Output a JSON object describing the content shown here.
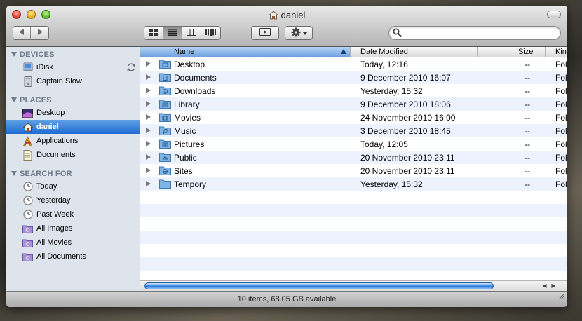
{
  "window": {
    "title": "daniel",
    "title_icon": "home-icon"
  },
  "toolbar": {
    "back_icon": "back-arrow-icon",
    "forward_icon": "forward-arrow-icon",
    "view_modes": [
      "icon-view-icon",
      "list-view-icon",
      "column-view-icon",
      "coverflow-view-icon"
    ],
    "active_view": "list-view-icon",
    "quicklook_icon": "quicklook-eye-icon",
    "action_icon": "gear-icon",
    "search": {
      "value": "",
      "placeholder": ""
    }
  },
  "sidebar": {
    "sections": [
      {
        "title": "DEVICES",
        "items": [
          {
            "label": "iDisk",
            "icon": "idisk-icon",
            "syncing": true
          },
          {
            "label": "Captain Slow",
            "icon": "computer-icon"
          }
        ]
      },
      {
        "title": "PLACES",
        "items": [
          {
            "label": "Desktop",
            "icon": "desktop-icon"
          },
          {
            "label": "daniel",
            "icon": "home-icon",
            "selected": true
          },
          {
            "label": "Applications",
            "icon": "applications-icon"
          },
          {
            "label": "Documents",
            "icon": "documents-icon"
          }
        ]
      },
      {
        "title": "SEARCH FOR",
        "items": [
          {
            "label": "Today",
            "icon": "clock-icon"
          },
          {
            "label": "Yesterday",
            "icon": "clock-icon"
          },
          {
            "label": "Past Week",
            "icon": "clock-icon"
          },
          {
            "label": "All Images",
            "icon": "smart-folder-icon"
          },
          {
            "label": "All Movies",
            "icon": "smart-folder-icon"
          },
          {
            "label": "All Documents",
            "icon": "smart-folder-icon"
          }
        ]
      }
    ]
  },
  "list": {
    "columns": [
      {
        "label": "Name",
        "sorted": true
      },
      {
        "label": "Date Modified"
      },
      {
        "label": "Size"
      },
      {
        "label": "Kin"
      }
    ],
    "rows": [
      {
        "name": "Desktop",
        "date": "Today, 12:16",
        "size": "--",
        "kind": "Fol",
        "icon": "desktop-folder-icon"
      },
      {
        "name": "Documents",
        "date": "9 December 2010 16:07",
        "size": "--",
        "kind": "Fol",
        "icon": "documents-folder-icon"
      },
      {
        "name": "Downloads",
        "date": "Yesterday, 15:32",
        "size": "--",
        "kind": "Fol",
        "icon": "downloads-folder-icon"
      },
      {
        "name": "Library",
        "date": "9 December 2010 18:06",
        "size": "--",
        "kind": "Fol",
        "icon": "library-folder-icon"
      },
      {
        "name": "Movies",
        "date": "24 November 2010 16:00",
        "size": "--",
        "kind": "Fol",
        "icon": "movies-folder-icon"
      },
      {
        "name": "Music",
        "date": "3 December 2010 18:45",
        "size": "--",
        "kind": "Fol",
        "icon": "music-folder-icon"
      },
      {
        "name": "Pictures",
        "date": "Today, 12:05",
        "size": "--",
        "kind": "Fol",
        "icon": "pictures-folder-icon"
      },
      {
        "name": "Public",
        "date": "20 November 2010 23:11",
        "size": "--",
        "kind": "Fol",
        "icon": "public-folder-icon"
      },
      {
        "name": "Sites",
        "date": "20 November 2010 23:11",
        "size": "--",
        "kind": "Fol",
        "icon": "sites-folder-icon"
      },
      {
        "name": "Tempory",
        "date": "Yesterday, 15:32",
        "size": "--",
        "kind": "Fol",
        "icon": "tempory-folder-icon"
      }
    ],
    "scroll_position": 0.0
  },
  "status": {
    "text": "10 items, 68.05 GB available"
  },
  "colors": {
    "selection": "#1f6cd3",
    "sidebar_bg": "#dde4ec",
    "sidebar_heading": "#6f7c8b",
    "alt_row": "#edf3fe",
    "folder_blue": "#6ea9dc"
  }
}
